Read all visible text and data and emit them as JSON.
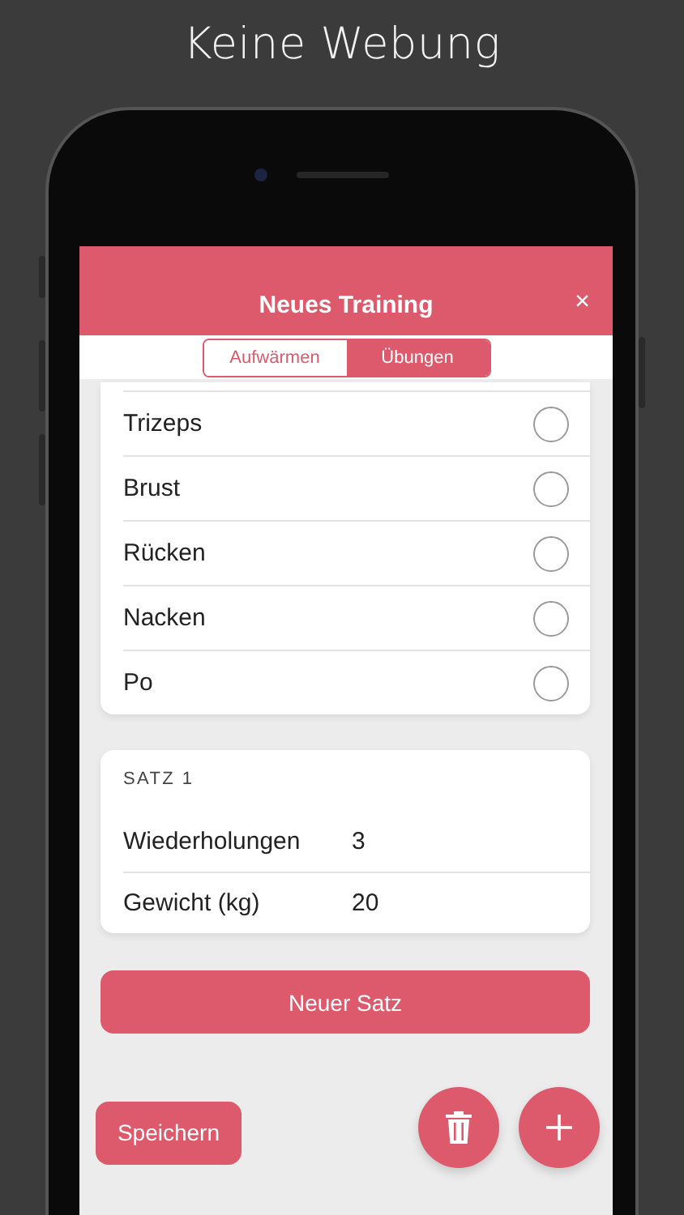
{
  "banner": {
    "title": "Keine Webung"
  },
  "header": {
    "title": "Neues Training",
    "close": "×"
  },
  "segments": [
    {
      "label": "Aufwärmen",
      "selected": false
    },
    {
      "label": "Übungen",
      "selected": true
    }
  ],
  "muscles": [
    {
      "label": "Trizeps",
      "checked": false
    },
    {
      "label": "Brust",
      "checked": false
    },
    {
      "label": "Rücken",
      "checked": false
    },
    {
      "label": "Nacken",
      "checked": false
    },
    {
      "label": "Po",
      "checked": false
    }
  ],
  "set": {
    "title": "SATZ 1",
    "fields": [
      {
        "label": "Wiederholungen",
        "value": "3"
      },
      {
        "label": "Gewicht (kg)",
        "value": "20"
      }
    ]
  },
  "new_set_button": "Neuer Satz",
  "save_button": "Speichern"
}
